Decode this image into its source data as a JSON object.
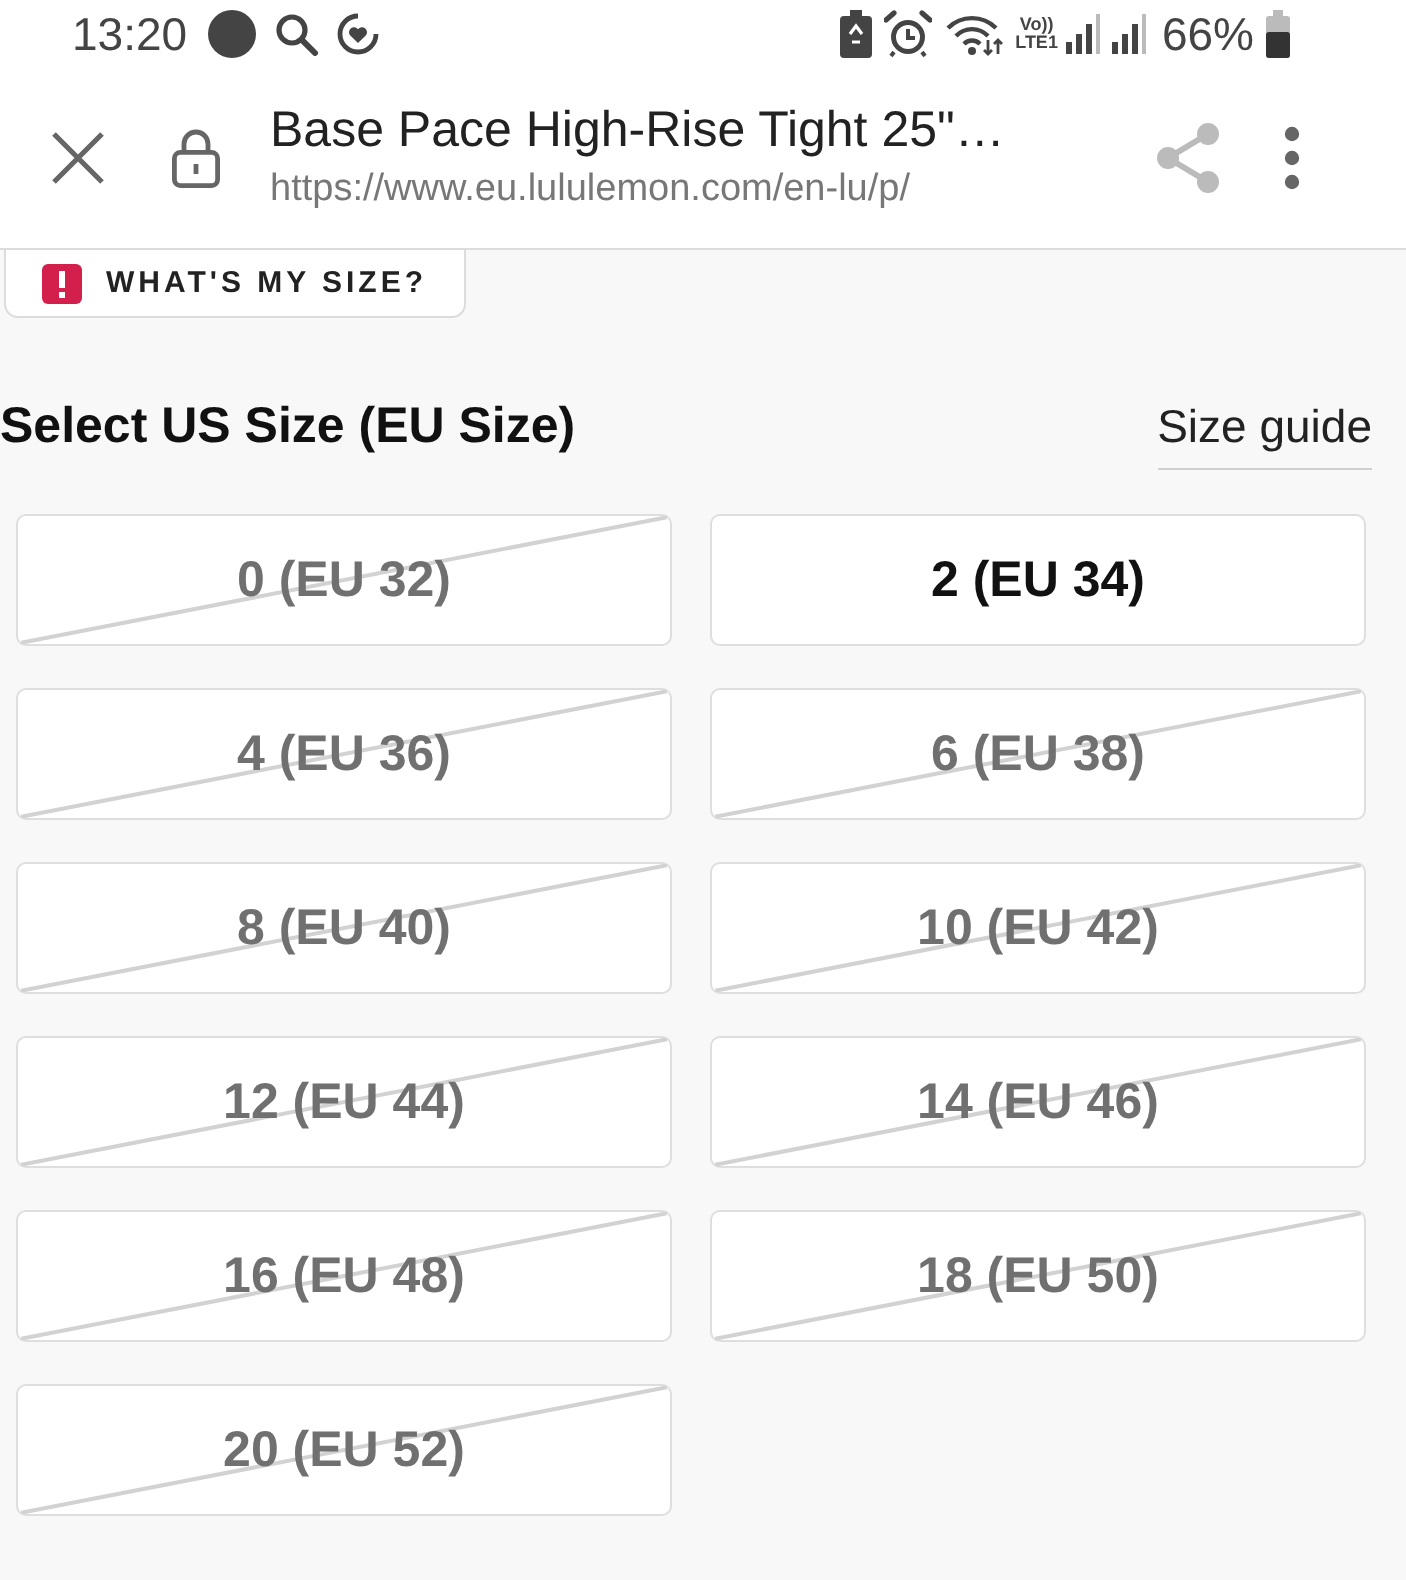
{
  "status_bar": {
    "time": "13:20",
    "network_top": "Vo))",
    "network_bottom": "LTE1",
    "battery": "66%"
  },
  "toolbar": {
    "title": "Base Pace High-Rise Tight 25\"…",
    "url": "https://www.eu.lululemon.com/en-lu/p/"
  },
  "size_help_button": {
    "label": "WHAT'S MY SIZE?"
  },
  "size_selector": {
    "heading": "Select US Size (EU Size)",
    "guide_link": "Size guide",
    "sizes": [
      {
        "label": "0 (EU 32)",
        "available": false
      },
      {
        "label": "2 (EU 34)",
        "available": true
      },
      {
        "label": "4 (EU 36)",
        "available": false
      },
      {
        "label": "6 (EU 38)",
        "available": false
      },
      {
        "label": "8 (EU 40)",
        "available": false
      },
      {
        "label": "10 (EU 42)",
        "available": false
      },
      {
        "label": "12 (EU 44)",
        "available": false
      },
      {
        "label": "14 (EU 46)",
        "available": false
      },
      {
        "label": "16 (EU 48)",
        "available": false
      },
      {
        "label": "18 (EU 50)",
        "available": false
      },
      {
        "label": "20 (EU 52)",
        "available": false
      }
    ]
  }
}
